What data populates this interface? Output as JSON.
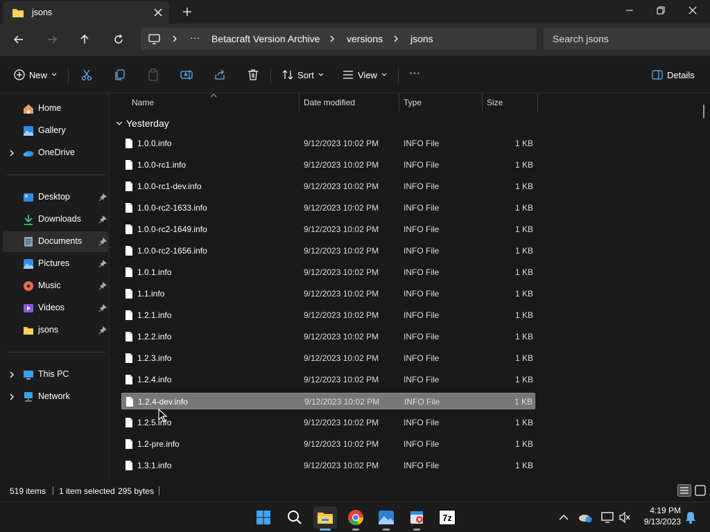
{
  "tab": {
    "title": "jsons"
  },
  "address": {
    "more": "···",
    "crumbs": [
      "Betacraft Version Archive",
      "versions",
      "jsons"
    ]
  },
  "search": {
    "placeholder": "Search jsons"
  },
  "commands": {
    "new": "New",
    "sort": "Sort",
    "view": "View",
    "more": "···",
    "details": "Details"
  },
  "sidebar": {
    "items": [
      {
        "label": "Home",
        "icon": "home-icon"
      },
      {
        "label": "Gallery",
        "icon": "gallery-icon"
      },
      {
        "label": "OneDrive",
        "icon": "onedrive-icon"
      },
      {
        "label": "Desktop",
        "icon": "desktop-icon"
      },
      {
        "label": "Downloads",
        "icon": "downloads-icon"
      },
      {
        "label": "Documents",
        "icon": "documents-icon"
      },
      {
        "label": "Pictures",
        "icon": "pictures-icon"
      },
      {
        "label": "Music",
        "icon": "music-icon"
      },
      {
        "label": "Videos",
        "icon": "videos-icon"
      },
      {
        "label": "jsons",
        "icon": "folder-icon"
      },
      {
        "label": "This PC",
        "icon": "pc-icon"
      },
      {
        "label": "Network",
        "icon": "network-icon"
      }
    ]
  },
  "columns": {
    "name": "Name",
    "date": "Date modified",
    "type": "Type",
    "size": "Size"
  },
  "group": {
    "label": "Yesterday"
  },
  "files": [
    {
      "name": "1.0.0.info",
      "date": "9/12/2023 10:02 PM",
      "type": "INFO File",
      "size": "1 KB"
    },
    {
      "name": "1.0.0-rc1.info",
      "date": "9/12/2023 10:02 PM",
      "type": "INFO File",
      "size": "1 KB"
    },
    {
      "name": "1.0.0-rc1-dev.info",
      "date": "9/12/2023 10:02 PM",
      "type": "INFO File",
      "size": "1 KB"
    },
    {
      "name": "1.0.0-rc2-1633.info",
      "date": "9/12/2023 10:02 PM",
      "type": "INFO File",
      "size": "1 KB"
    },
    {
      "name": "1.0.0-rc2-1649.info",
      "date": "9/12/2023 10:02 PM",
      "type": "INFO File",
      "size": "1 KB"
    },
    {
      "name": "1.0.0-rc2-1656.info",
      "date": "9/12/2023 10:02 PM",
      "type": "INFO File",
      "size": "1 KB"
    },
    {
      "name": "1.0.1.info",
      "date": "9/12/2023 10:02 PM",
      "type": "INFO File",
      "size": "1 KB"
    },
    {
      "name": "1.1.info",
      "date": "9/12/2023 10:02 PM",
      "type": "INFO File",
      "size": "1 KB"
    },
    {
      "name": "1.2.1.info",
      "date": "9/12/2023 10:02 PM",
      "type": "INFO File",
      "size": "1 KB"
    },
    {
      "name": "1.2.2.info",
      "date": "9/12/2023 10:02 PM",
      "type": "INFO File",
      "size": "1 KB"
    },
    {
      "name": "1.2.3.info",
      "date": "9/12/2023 10:02 PM",
      "type": "INFO File",
      "size": "1 KB"
    },
    {
      "name": "1.2.4.info",
      "date": "9/12/2023 10:02 PM",
      "type": "INFO File",
      "size": "1 KB"
    },
    {
      "name": "1.2.4-dev.info",
      "date": "9/12/2023 10:02 PM",
      "type": "INFO File",
      "size": "1 KB",
      "selected": true
    },
    {
      "name": "1.2.5.info",
      "date": "9/12/2023 10:02 PM",
      "type": "INFO File",
      "size": "1 KB"
    },
    {
      "name": "1.2-pre.info",
      "date": "9/12/2023 10:02 PM",
      "type": "INFO File",
      "size": "1 KB"
    },
    {
      "name": "1.3.1.info",
      "date": "9/12/2023 10:02 PM",
      "type": "INFO File",
      "size": "1 KB"
    }
  ],
  "status": {
    "count": "519 items",
    "selected": "1 item selected",
    "bytes": "295 bytes"
  },
  "taskbar": {
    "time": "4:19 PM",
    "date": "9/13/2023",
    "sevenzip": "7z"
  },
  "colors": {
    "accent": "#5fb2f2",
    "folder": "#f3c34a",
    "selection": "#777777"
  }
}
